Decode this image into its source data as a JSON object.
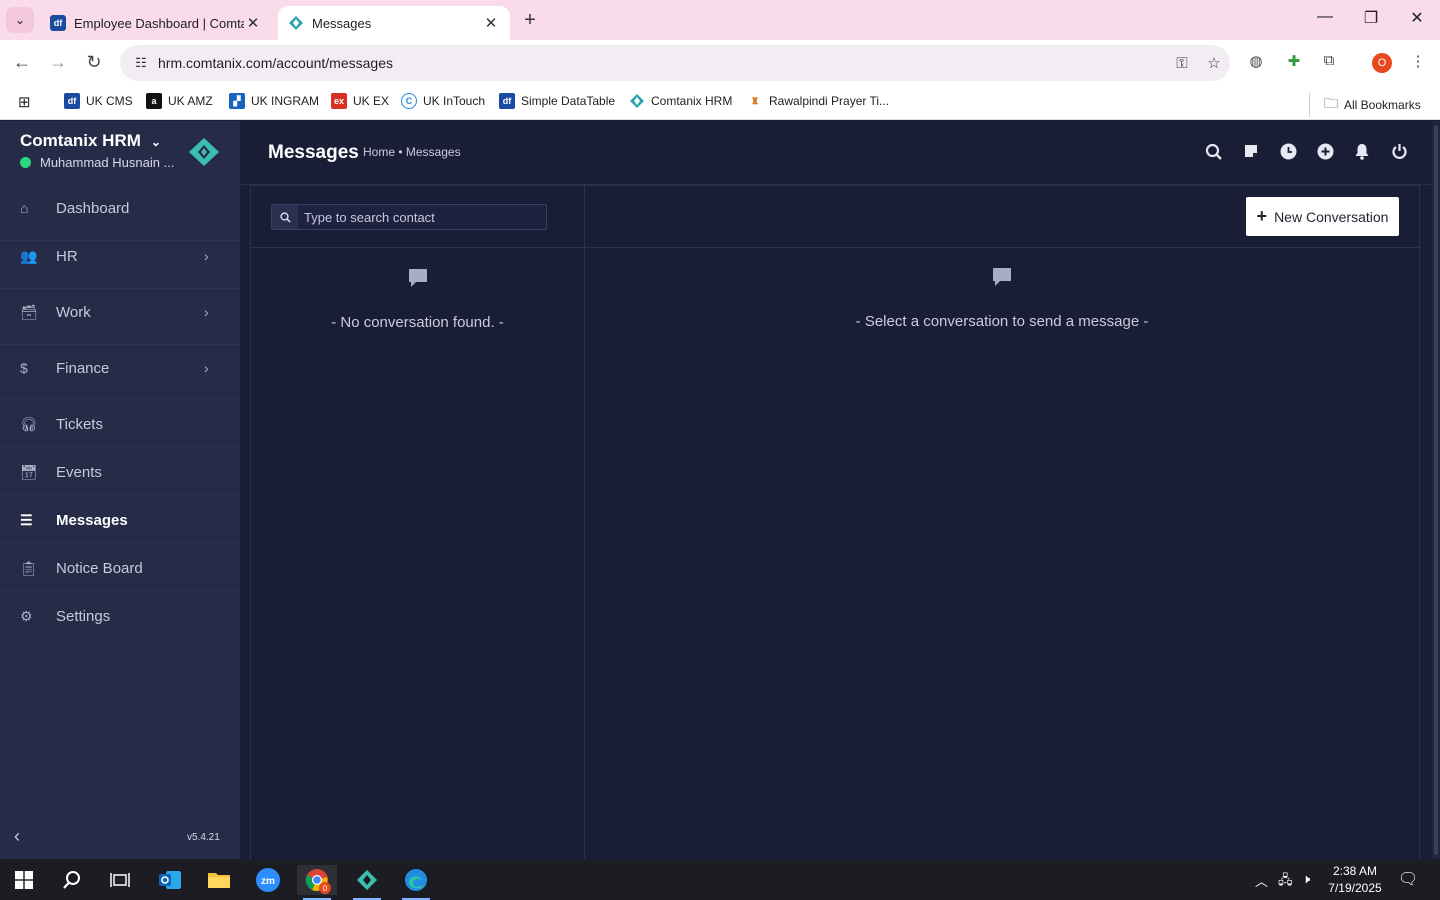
{
  "browser": {
    "tabs": [
      {
        "title": "Employee Dashboard | Comtanix",
        "active": false
      },
      {
        "title": "Messages",
        "active": true
      }
    ],
    "url": "hrm.comtanix.com/account/messages",
    "profile_initial": "O",
    "bookmarks": [
      {
        "label": "UK CMS",
        "icon": "df-icon",
        "color": "#1b4ba0"
      },
      {
        "label": "UK AMZ",
        "icon": "amazon-icon",
        "color": "#111111"
      },
      {
        "label": "UK INGRAM",
        "icon": "ingram-icon",
        "color": "#1565c0"
      },
      {
        "label": "UK EX",
        "icon": "ex-icon",
        "color": "#d93025"
      },
      {
        "label": "UK InTouch",
        "icon": "intouch-icon",
        "color": "#1e88e5"
      },
      {
        "label": "Simple DataTable",
        "icon": "df-icon",
        "color": "#1b4ba0"
      },
      {
        "label": "Comtanix HRM",
        "icon": "comtanix-icon",
        "color": "#2fa3b5"
      },
      {
        "label": "Rawalpindi Prayer Ti...",
        "icon": "prayer-icon",
        "color": "#e07a1f"
      }
    ],
    "all_bookmarks": "All Bookmarks"
  },
  "sidebar": {
    "brand": "Comtanix HRM",
    "user": "Muhammad Husnain ...",
    "items": [
      {
        "label": "Dashboard",
        "icon": "home-icon",
        "has_arrow": false,
        "active": false
      },
      {
        "label": "HR",
        "icon": "users-icon",
        "has_arrow": true,
        "active": false
      },
      {
        "label": "Work",
        "icon": "briefcase-icon",
        "has_arrow": true,
        "active": false
      },
      {
        "label": "Finance",
        "icon": "dollar-icon",
        "has_arrow": true,
        "active": false
      },
      {
        "label": "Tickets",
        "icon": "headset-icon",
        "has_arrow": false,
        "active": false
      },
      {
        "label": "Events",
        "icon": "calendar-icon",
        "has_arrow": false,
        "active": false
      },
      {
        "label": "Messages",
        "icon": "message-icon",
        "has_arrow": false,
        "active": true
      },
      {
        "label": "Notice Board",
        "icon": "clipboard-icon",
        "has_arrow": false,
        "active": false
      },
      {
        "label": "Settings",
        "icon": "gear-icon",
        "has_arrow": false,
        "active": false
      }
    ],
    "version": "v5.4.21"
  },
  "header": {
    "title": "Messages",
    "breadcrumb": "Home • Messages"
  },
  "contacts": {
    "search_placeholder": "Type to search contact",
    "empty_text": "- No conversation found. -"
  },
  "conversation": {
    "new_button": "New Conversation",
    "empty_text": "- Select a conversation to send a message -"
  },
  "taskbar": {
    "time": "2:38 AM",
    "date": "7/19/2025",
    "chrome_badge": "0"
  },
  "colors": {
    "app_bg": "#1a1d36",
    "sidebar_bg": "#262b48",
    "online": "#2bd97c",
    "tab_bar": "#f9dbe9"
  }
}
